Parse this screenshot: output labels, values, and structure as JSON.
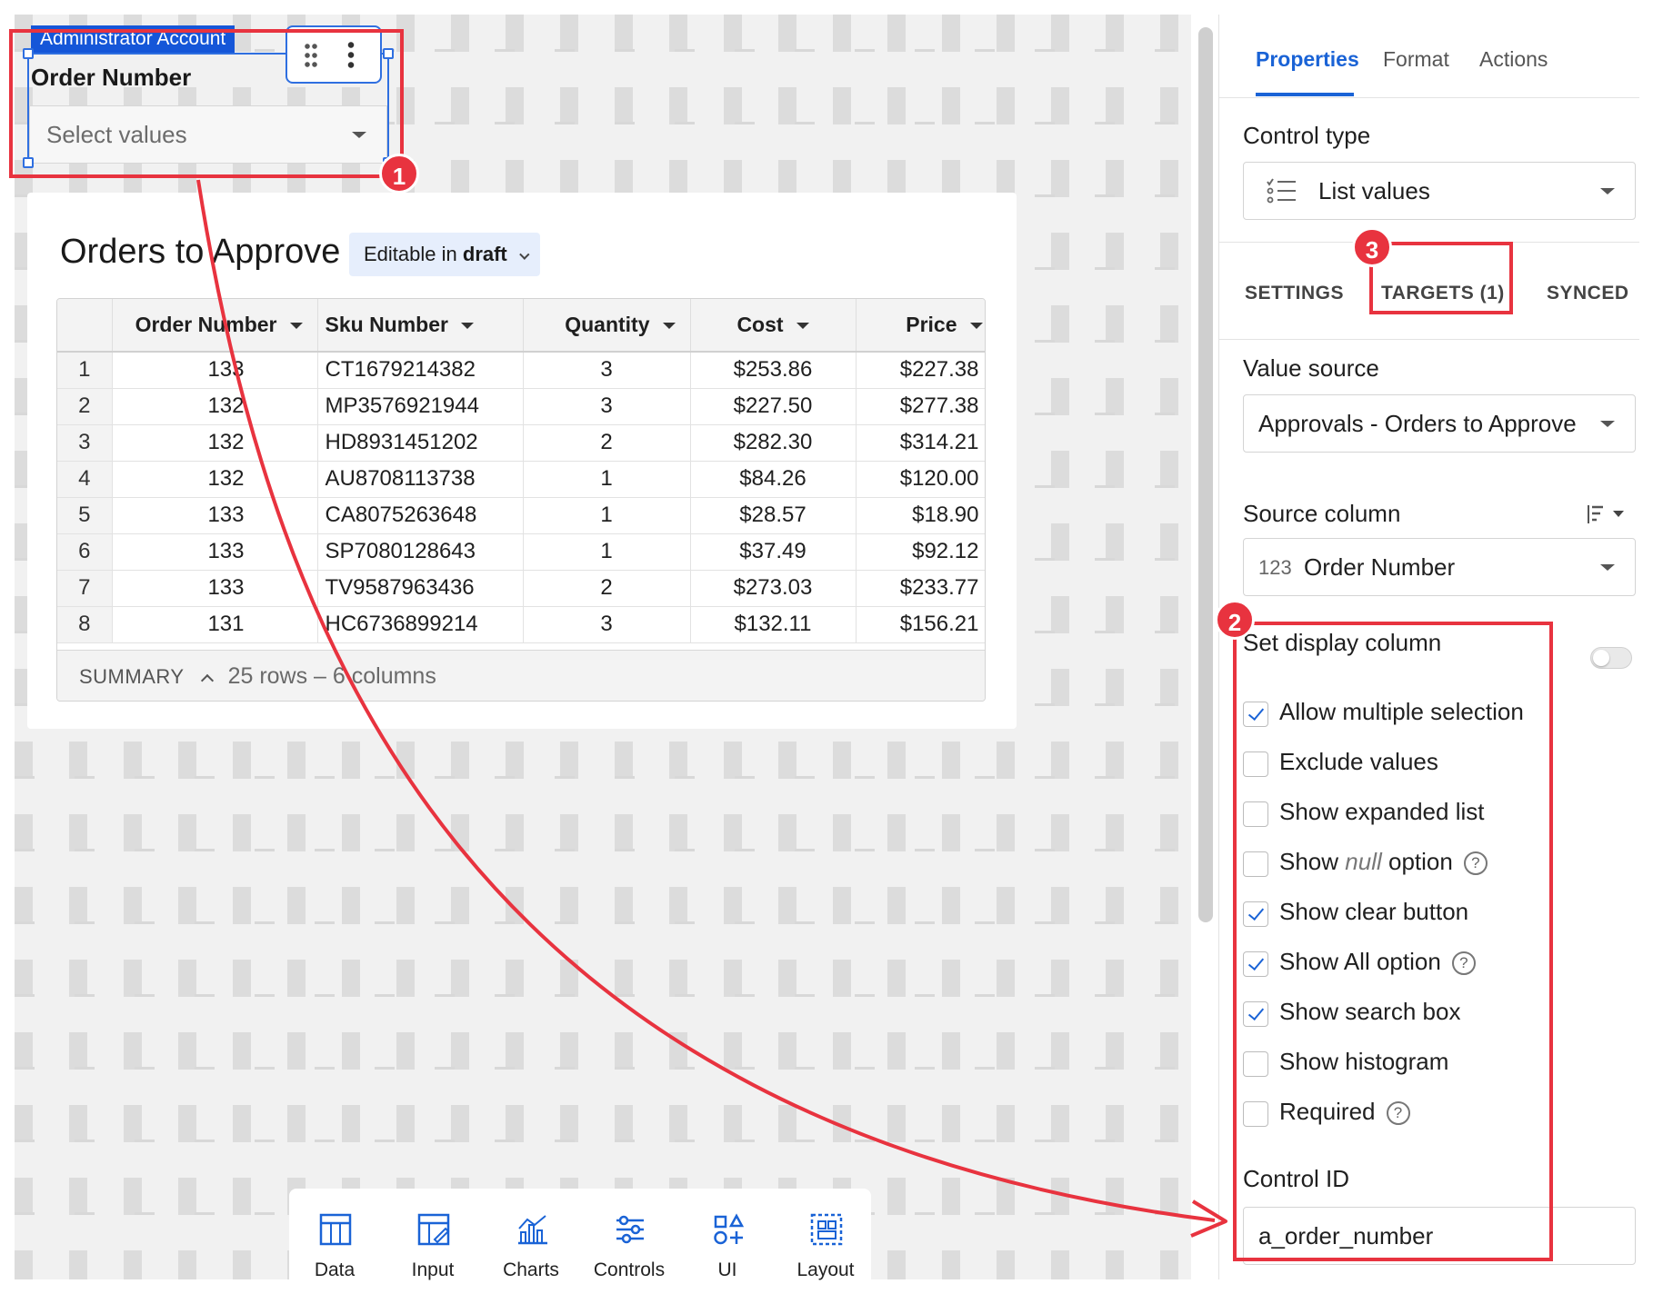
{
  "control": {
    "badge": "Administrator Account",
    "title": "Order Number",
    "placeholder": "Select values"
  },
  "table_card": {
    "title": "Orders to Approve",
    "edit_pill_prefix": "Editable in",
    "edit_pill_bold": "draft",
    "columns": [
      "Order Number",
      "Sku Number",
      "Quantity",
      "Cost",
      "Price"
    ],
    "rows": [
      [
        "1",
        "133",
        "CT1679214382",
        "3",
        "$253.86",
        "$227.38"
      ],
      [
        "2",
        "132",
        "MP3576921944",
        "3",
        "$227.50",
        "$277.38"
      ],
      [
        "3",
        "132",
        "HD8931451202",
        "2",
        "$282.30",
        "$314.21"
      ],
      [
        "4",
        "132",
        "AU8708113738",
        "1",
        "$84.26",
        "$120.00"
      ],
      [
        "5",
        "133",
        "CA8075263648",
        "1",
        "$28.57",
        "$18.90"
      ],
      [
        "6",
        "133",
        "SP7080128643",
        "1",
        "$37.49",
        "$92.12"
      ],
      [
        "7",
        "133",
        "TV9587963436",
        "2",
        "$273.03",
        "$233.77"
      ],
      [
        "8",
        "131",
        "HC6736899214",
        "3",
        "$132.11",
        "$156.21"
      ]
    ],
    "summary_label": "SUMMARY",
    "summary_text": "25 rows – 6 columns"
  },
  "bottom_toolbar": [
    {
      "label": "Data",
      "icon": "table-icon"
    },
    {
      "label": "Input",
      "icon": "input-table-icon"
    },
    {
      "label": "Charts",
      "icon": "chart-icon"
    },
    {
      "label": "Controls",
      "icon": "sliders-icon"
    },
    {
      "label": "UI",
      "icon": "shapes-icon"
    },
    {
      "label": "Layout",
      "icon": "layout-icon"
    }
  ],
  "panel": {
    "tabs": [
      "Properties",
      "Format",
      "Actions"
    ],
    "control_type_label": "Control type",
    "control_type_value": "List values",
    "subtabs": [
      "SETTINGS",
      "TARGETS (1)",
      "SYNCED"
    ],
    "value_source_label": "Value source",
    "value_source_value": "Approvals - Orders to Approve",
    "source_column_label": "Source column",
    "source_column_type": "123",
    "source_column_value": "Order Number",
    "set_display_column": "Set display column",
    "options": [
      {
        "label": "Allow multiple selection",
        "checked": true,
        "help": false
      },
      {
        "label": "Exclude values",
        "checked": false,
        "help": false
      },
      {
        "label": "Show expanded list",
        "checked": false,
        "help": false
      },
      {
        "label": "Show null option",
        "checked": false,
        "help": true
      },
      {
        "label": "Show clear button",
        "checked": true,
        "help": false
      },
      {
        "label": "Show All option",
        "checked": true,
        "help": true
      },
      {
        "label": "Show search box",
        "checked": true,
        "help": false
      },
      {
        "label": "Show histogram",
        "checked": false,
        "help": false
      },
      {
        "label": "Required",
        "checked": false,
        "help": true
      }
    ],
    "null_word": "null",
    "show_word": "Show",
    "option_word": "option",
    "control_id_label": "Control ID",
    "control_id_value": "a_order_number"
  },
  "annotations": {
    "markers": [
      "1",
      "2",
      "3"
    ],
    "color": "#e8333f"
  },
  "colors": {
    "accent": "#1a63d6",
    "selection": "#2f6fe0",
    "badge": "#1556d8"
  }
}
